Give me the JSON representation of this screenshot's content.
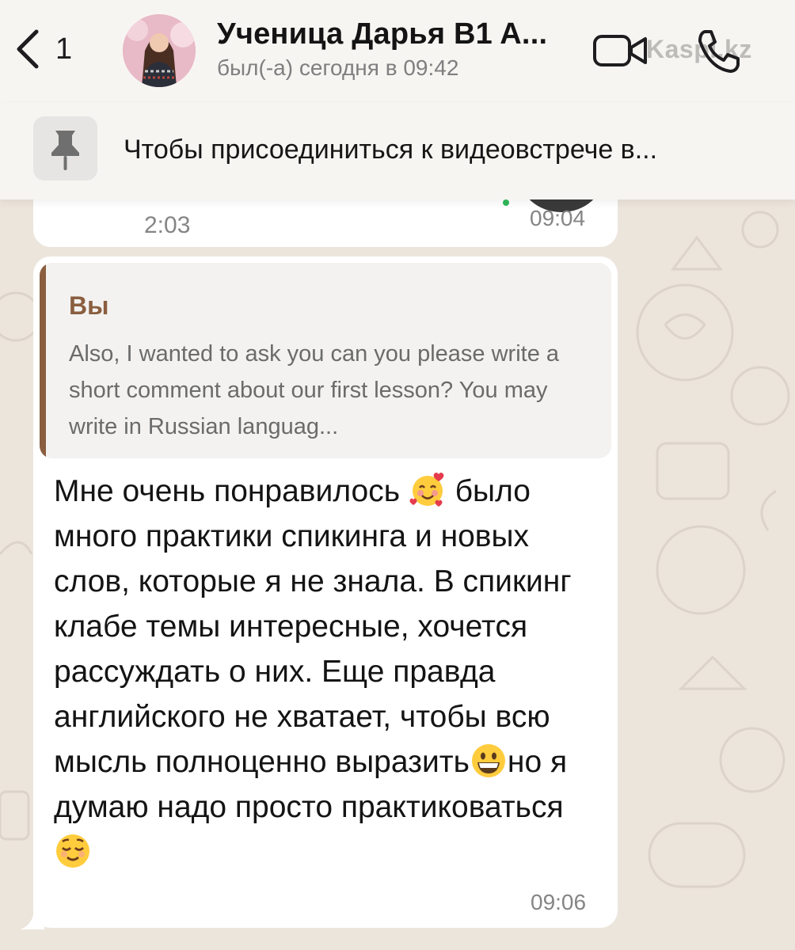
{
  "header": {
    "back_count": "1",
    "contact_name": "Ученица Дарья B1 A...",
    "status": "был(-а) сегодня в 09:42",
    "avatar_icon": "contact-avatar",
    "video_icon": "video-camera-icon",
    "call_icon": "phone-icon",
    "watermark": "Kaspi.kz"
  },
  "pinned": {
    "icon": "pin-icon",
    "text": "Чтобы присоединиться к видеовстрече в..."
  },
  "previous_message": {
    "duration": "2:03",
    "time": "09:04"
  },
  "message": {
    "quote": {
      "author": "Вы",
      "text": "Also, I wanted to ask you can you please write a short comment about our first lesson? You may write in Russian languag..."
    },
    "line1_a": "Мне очень понравилось ",
    "line1_b": " было",
    "text_mid": "много практики спикинга и новых слов, которые я не знала. В спикинг клабе темы интересные, хочется рассуждать о них. Еще правда английского не хватает, чтобы всю мысль полноценно выразить",
    "text_after_grin": "но я думаю надо просто практиковаться ",
    "emojis": [
      "smiling-face-with-hearts",
      "grinning-face",
      "relieved-face"
    ],
    "time": "09:06"
  },
  "colors": {
    "header_bg": "#f7f5f2",
    "quote_accent": "#8a5e3f",
    "bubble_bg": "#ffffff",
    "chat_bg": "#ece5dc"
  }
}
